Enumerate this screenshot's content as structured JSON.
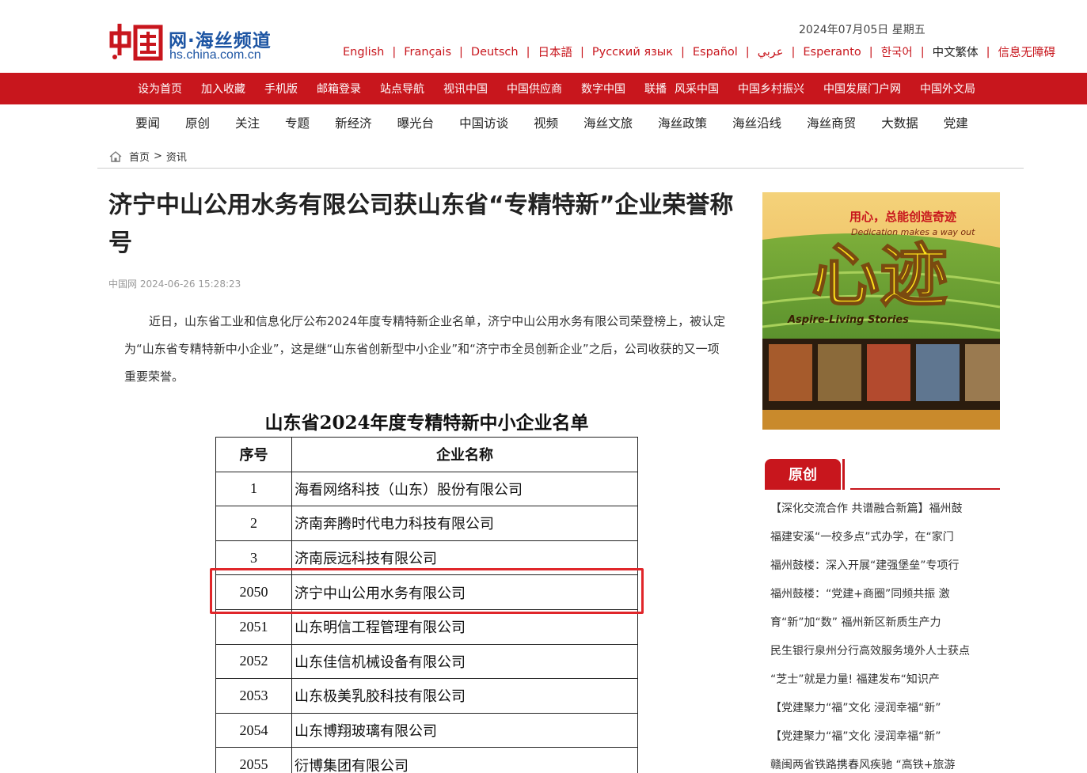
{
  "header": {
    "logo_main": "网·海丝频道",
    "logo_url": "hs.china.com.cn",
    "date": "2024年07月05日   星期五",
    "languages": [
      "English",
      "Français",
      "Deutsch",
      "日本語",
      "Русский язык",
      "Español",
      "عربي",
      "Esperanto",
      "한국어",
      "中文繁体",
      "信息无障碍"
    ]
  },
  "red_nav": [
    "设为首页",
    "加入收藏",
    "手机版",
    "邮箱登录",
    "站点导航",
    "视讯中国",
    "中国供应商",
    "数字中国",
    "联播",
    "风采中国",
    "中国乡村振兴",
    "中国发展门户网",
    "中国外文局"
  ],
  "sub_nav": [
    "要闻",
    "原创",
    "关注",
    "专题",
    "新经济",
    "曝光台",
    "中国访谈",
    "视频",
    "海丝文旅",
    "海丝政策",
    "海丝沿线",
    "海丝商贸",
    "大数据",
    "党建"
  ],
  "breadcrumb": {
    "home": "首页",
    "separator": ">",
    "current": "资讯"
  },
  "article": {
    "title": "济宁中山公用水务有限公司获山东省“专精特新”企业荣誉称号",
    "meta": "中国网 2024-06-26 15:28:23",
    "paragraph": "近日，山东省工业和信息化厅公布2024年度专精特新企业名单，济宁中山公用水务有限公司荣登榜上，被认定为“山东省专精特新中小企业”，这是继“山东省创新型中小企业”和“济宁市全员创新企业”之后，公司收获的又一项重要荣誉。"
  },
  "list_image": {
    "title": "山东省2024年度专精特新中小企业名单",
    "headers": [
      "序号",
      "企业名称"
    ],
    "rows": [
      {
        "no": "1",
        "name": "海看网络科技（山东）股份有限公司"
      },
      {
        "no": "2",
        "name": "济南奔腾时代电力科技有限公司"
      },
      {
        "no": "3",
        "name": "济南辰远科技有限公司"
      },
      {
        "no": "2050",
        "name": "济宁中山公用水务有限公司"
      },
      {
        "no": "2051",
        "name": "山东明信工程管理有限公司"
      },
      {
        "no": "2052",
        "name": "山东佳信机械设备有限公司"
      },
      {
        "no": "2053",
        "name": "山东极美乳胶科技有限公司"
      },
      {
        "no": "2054",
        "name": "山东博翔玻璃有限公司"
      },
      {
        "no": "2055",
        "name": "衍博集团有限公司"
      }
    ],
    "highlight_color": "#e0262a"
  },
  "sidebar": {
    "ad": {
      "slogan": "用心，总能创造奇迹",
      "slogan_en": "Dedication makes a way out",
      "big_text": "心迹",
      "subtitle": "Aspire-Living Stories"
    },
    "section_title": "原创",
    "items": [
      "【深化交流合作 共谱融合新篇】福州鼓",
      "福建安溪“一校多点”式办学，在“家门",
      "福州鼓楼：深入开展“建强堡垒”专项行",
      "福州鼓楼：“党建+商圈”同频共振 激",
      "育“新”加“数” 福州新区新质生产力",
      "民生银行泉州分行高效服务境外人士获点",
      "“芝士”就是力量! 福建发布“知识产",
      "【党建聚力“福”文化 浸润幸福“新”",
      "【党建聚力“福”文化 浸润幸福“新”",
      "赣闽两省铁路携春风疾驰 “高铁+旅游"
    ]
  },
  "colors": {
    "brand_red": "#c8161d",
    "logo_blue": "#1d55a3"
  }
}
